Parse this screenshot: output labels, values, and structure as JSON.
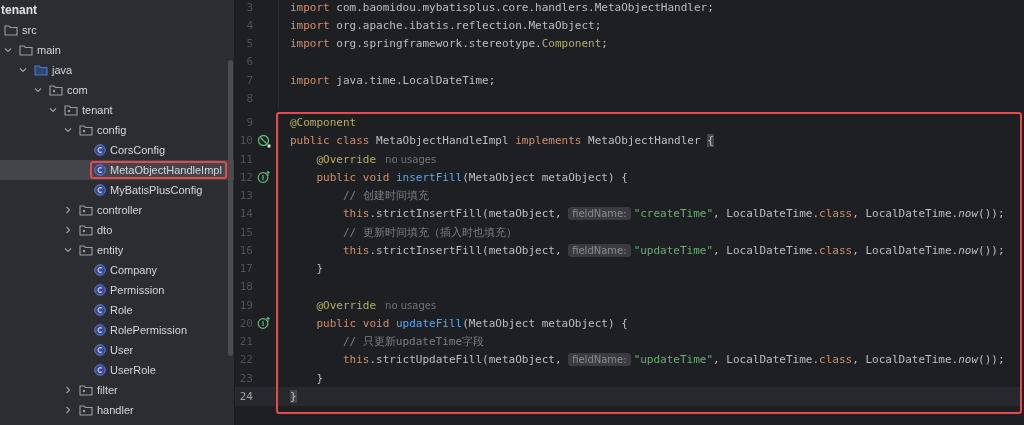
{
  "project": {
    "title": "tenant"
  },
  "tree": [
    {
      "label": "src",
      "kind": "folder",
      "children": [
        {
          "label": "main",
          "kind": "folder",
          "expanded": true,
          "children": [
            {
              "label": "java",
              "kind": "source_folder",
              "expanded": true,
              "children": [
                {
                  "label": "com",
                  "kind": "package",
                  "expanded": true,
                  "children": [
                    {
                      "label": "tenant",
                      "kind": "package",
                      "expanded": true,
                      "children": [
                        {
                          "label": "config",
                          "kind": "package",
                          "expanded": true,
                          "children": [
                            {
                              "label": "CorsConfig",
                              "kind": "class",
                              "selected": false,
                              "framed": false
                            },
                            {
                              "label": "MetaObjectHandleImpl",
                              "kind": "class",
                              "selected": true,
                              "framed": true
                            },
                            {
                              "label": "MyBatisPlusConfig",
                              "kind": "class",
                              "selected": false,
                              "framed": false
                            }
                          ]
                        },
                        {
                          "label": "controller",
                          "kind": "package",
                          "expanded": false
                        },
                        {
                          "label": "dto",
                          "kind": "package",
                          "expanded": false
                        },
                        {
                          "label": "entity",
                          "kind": "package",
                          "expanded": true,
                          "children": [
                            {
                              "label": "Company",
                              "kind": "class",
                              "selected": false,
                              "framed": false
                            },
                            {
                              "label": "Permission",
                              "kind": "class",
                              "selected": false,
                              "framed": false
                            },
                            {
                              "label": "Role",
                              "kind": "class",
                              "selected": false,
                              "framed": false
                            },
                            {
                              "label": "RolePermission",
                              "kind": "class",
                              "selected": false,
                              "framed": false
                            },
                            {
                              "label": "User",
                              "kind": "class",
                              "selected": false,
                              "framed": false
                            },
                            {
                              "label": "UserRole",
                              "kind": "class",
                              "selected": false,
                              "framed": false
                            }
                          ]
                        },
                        {
                          "label": "filter",
                          "kind": "package",
                          "expanded": false
                        },
                        {
                          "label": "handler",
                          "kind": "package",
                          "expanded": false
                        }
                      ]
                    }
                  ]
                }
              ]
            }
          ]
        }
      ]
    }
  ],
  "editor": {
    "lines": [
      {
        "number": "3",
        "selected": false,
        "tokens": [
          {
            "text": "import ",
            "kind": "keyword"
          },
          {
            "text": "com.baomidou.mybatisplus.core.handlers.MetaObjectHandler;",
            "kind": "plain"
          }
        ]
      },
      {
        "number": "4",
        "selected": false,
        "tokens": [
          {
            "text": "import ",
            "kind": "keyword"
          },
          {
            "text": "org.apache.ibatis.reflection.MetaObject;",
            "kind": "plain"
          }
        ]
      },
      {
        "number": "5",
        "selected": false,
        "tokens": [
          {
            "text": "import ",
            "kind": "keyword"
          },
          {
            "text": "org.springframework.stereotype.",
            "kind": "plain"
          },
          {
            "text": "Component",
            "kind": "annotation"
          },
          {
            "text": ";",
            "kind": "plain"
          }
        ]
      },
      {
        "number": "6",
        "selected": false
      },
      {
        "number": "7",
        "selected": false,
        "tokens": [
          {
            "text": "import ",
            "kind": "keyword"
          },
          {
            "text": "java.time.LocalDateTime;",
            "kind": "plain"
          }
        ]
      },
      {
        "number": "8",
        "selected": false
      }
    ],
    "highlight_box": {
      "lines": [
        {
          "number": "9",
          "selected": false,
          "tokens": [
            {
              "text": "@Component",
              "kind": "annotation"
            }
          ]
        },
        {
          "number": "10",
          "selected": false,
          "marker": {
            "kind": "bean"
          },
          "tokens": [
            {
              "text": "public class ",
              "kind": "keyword"
            },
            {
              "text": "MetaObjectHandleImpl ",
              "kind": "plain"
            },
            {
              "text": "implements ",
              "kind": "keyword"
            },
            {
              "text": "MetaObjectHandler ",
              "kind": "plain"
            },
            {
              "text": "{",
              "kind": "brace_match"
            }
          ]
        },
        {
          "number": "11",
          "selected": false,
          "tokens": [
            {
              "text": "    @Override",
              "kind": "annotation"
            },
            {
              "text": "no usages",
              "kind": "usage_hint"
            }
          ]
        },
        {
          "number": "12",
          "selected": false,
          "marker": {
            "kind": "override"
          },
          "tokens": [
            {
              "text": "    public void ",
              "kind": "keyword"
            },
            {
              "text": "insertFill",
              "kind": "method"
            },
            {
              "text": "(MetaObject metaObject) {",
              "kind": "plain"
            }
          ]
        },
        {
          "number": "13",
          "selected": false,
          "tokens": [
            {
              "text": "        // 创建时间填充",
              "kind": "comment"
            }
          ]
        },
        {
          "number": "14",
          "selected": false,
          "tokens": [
            {
              "text": "        this",
              "kind": "keyword"
            },
            {
              "text": ".strictInsertFill(metaObject, ",
              "kind": "plain"
            },
            {
              "text": "fieldName:",
              "kind": "param_hint"
            },
            {
              "text": "\"createTime\"",
              "kind": "string"
            },
            {
              "text": ", LocalDateTime.",
              "kind": "plain"
            },
            {
              "text": "class",
              "kind": "keyword"
            },
            {
              "text": ", LocalDateTime.",
              "kind": "plain"
            },
            {
              "text": "now",
              "kind": "static_call"
            },
            {
              "text": "());",
              "kind": "plain"
            }
          ]
        },
        {
          "number": "15",
          "selected": false,
          "tokens": [
            {
              "text": "        // 更新时间填充（插入时也填充）",
              "kind": "comment"
            }
          ]
        },
        {
          "number": "16",
          "selected": false,
          "tokens": [
            {
              "text": "        this",
              "kind": "keyword"
            },
            {
              "text": ".strictInsertFill(metaObject, ",
              "kind": "plain"
            },
            {
              "text": "fieldName:",
              "kind": "param_hint"
            },
            {
              "text": "\"updateTime\"",
              "kind": "string"
            },
            {
              "text": ", LocalDateTime.",
              "kind": "plain"
            },
            {
              "text": "class",
              "kind": "keyword"
            },
            {
              "text": ", LocalDateTime.",
              "kind": "plain"
            },
            {
              "text": "now",
              "kind": "static_call"
            },
            {
              "text": "());",
              "kind": "plain"
            }
          ]
        },
        {
          "number": "17",
          "selected": false,
          "tokens": [
            {
              "text": "    }",
              "kind": "plain"
            }
          ]
        },
        {
          "number": "18",
          "selected": false
        },
        {
          "number": "19",
          "selected": false,
          "tokens": [
            {
              "text": "    @Override",
              "kind": "annotation"
            },
            {
              "text": "no usages",
              "kind": "usage_hint"
            }
          ]
        },
        {
          "number": "20",
          "selected": false,
          "marker": {
            "kind": "override"
          },
          "tokens": [
            {
              "text": "    public void ",
              "kind": "keyword"
            },
            {
              "text": "updateFill",
              "kind": "method"
            },
            {
              "text": "(MetaObject metaObject) {",
              "kind": "plain"
            }
          ]
        },
        {
          "number": "21",
          "selected": false,
          "tokens": [
            {
              "text": "        // 只更新updateTime字段",
              "kind": "comment"
            }
          ]
        },
        {
          "number": "22",
          "selected": false,
          "tokens": [
            {
              "text": "        this",
              "kind": "keyword"
            },
            {
              "text": ".strictUpdateFill(metaObject, ",
              "kind": "plain"
            },
            {
              "text": "fieldName:",
              "kind": "param_hint"
            },
            {
              "text": "\"updateTime\"",
              "kind": "string"
            },
            {
              "text": ", LocalDateTime.",
              "kind": "plain"
            },
            {
              "text": "class",
              "kind": "keyword"
            },
            {
              "text": ", LocalDateTime.",
              "kind": "plain"
            },
            {
              "text": "now",
              "kind": "static_call"
            },
            {
              "text": "());",
              "kind": "plain"
            }
          ]
        },
        {
          "number": "23",
          "selected": false,
          "tokens": [
            {
              "text": "    }",
              "kind": "plain"
            }
          ]
        },
        {
          "number": "24",
          "selected": true,
          "tokens": [
            {
              "text": "}",
              "kind": "brace_match"
            }
          ]
        }
      ]
    }
  }
}
